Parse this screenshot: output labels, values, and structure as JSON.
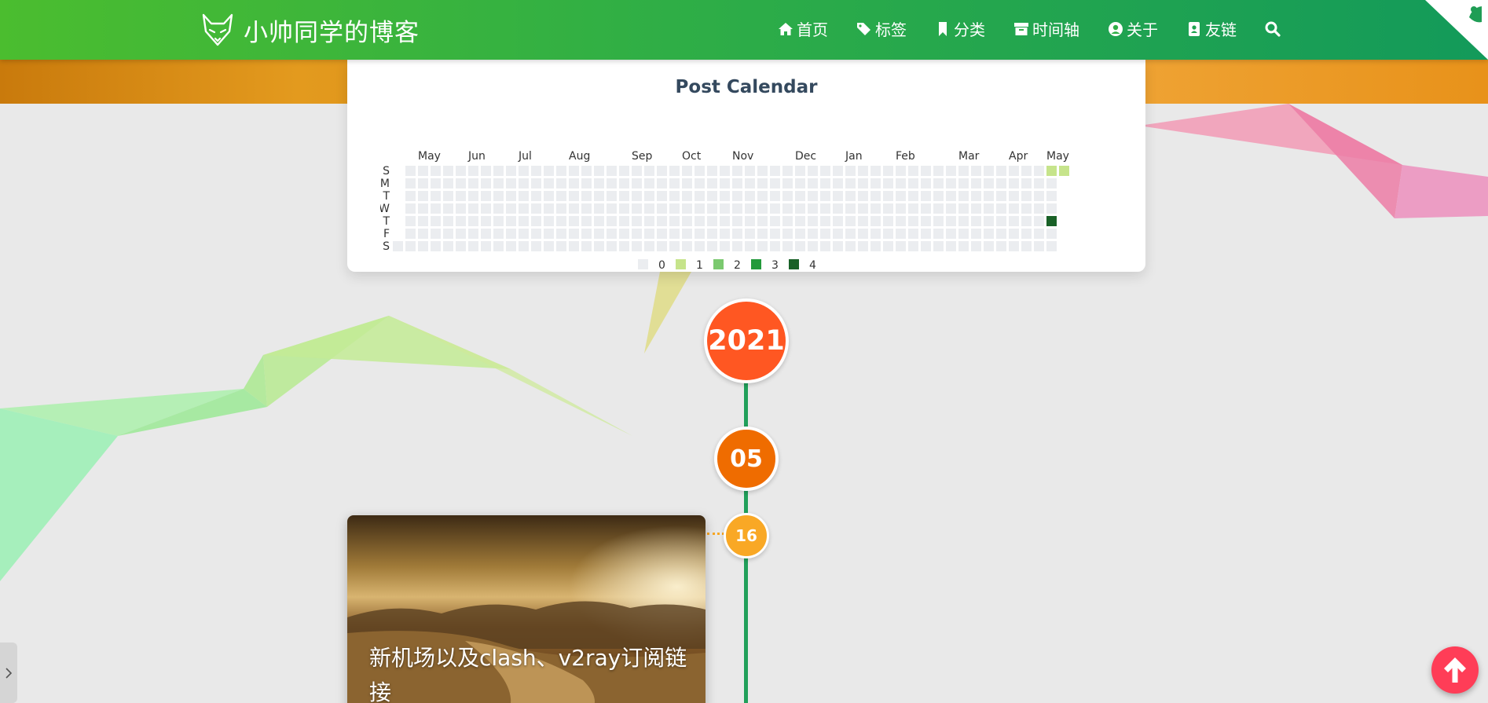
{
  "site": {
    "brand_title": "小帅同学的博客",
    "logo_icon": "fox-icon"
  },
  "nav": {
    "items": [
      {
        "label": "首页",
        "icon": "home-icon"
      },
      {
        "label": "标签",
        "icon": "tags-icon"
      },
      {
        "label": "分类",
        "icon": "bookmark-icon"
      },
      {
        "label": "时间轴",
        "icon": "archive-icon"
      },
      {
        "label": "关于",
        "icon": "user-circle-icon"
      },
      {
        "label": "友链",
        "icon": "address-book-icon"
      }
    ],
    "search_icon": "search-icon"
  },
  "calendar": {
    "title": "Post Calendar",
    "month_labels": [
      "May",
      "Jun",
      "Jul",
      "Aug",
      "Sep",
      "Oct",
      "Nov",
      "Dec",
      "Jan",
      "Feb",
      "Mar",
      "Apr",
      "May"
    ],
    "day_labels": [
      "S",
      "M",
      "T",
      "W",
      "T",
      "F",
      "S"
    ],
    "legend": [
      "0",
      "1",
      "2",
      "3",
      "4"
    ],
    "colors": [
      "#ebedf0",
      "#c6e48b",
      "#7bc96f",
      "#239a3b",
      "#196127"
    ],
    "active_cells": [
      {
        "week": 52,
        "day": 0,
        "level": 1
      },
      {
        "week": 53,
        "day": 0,
        "level": 1
      },
      {
        "week": 52,
        "day": 4,
        "level": 4
      }
    ]
  },
  "timeline": {
    "year": "2021",
    "month": "05",
    "day": "16",
    "line_color": "#21a05a",
    "year_color": "#ff5722",
    "month_color": "#ef6c00",
    "day_color": "#f9a825"
  },
  "post": {
    "title": "新机场以及clash、v2ray订阅链接"
  },
  "controls": {
    "back_to_top_icon": "arrow-up-icon",
    "side_toggle_icon": "chevron-right-icon"
  }
}
